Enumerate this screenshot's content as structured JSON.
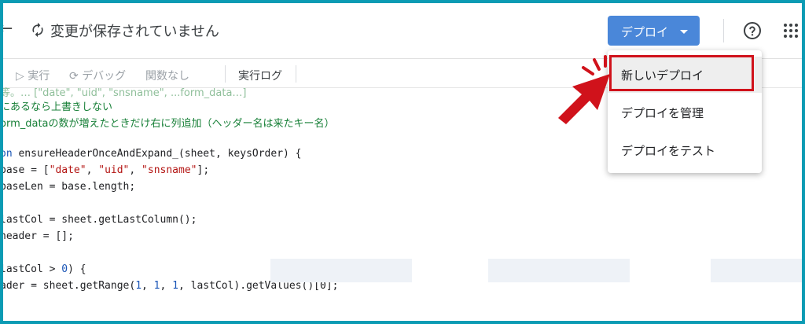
{
  "header": {
    "back_glyph": "←",
    "status": "変更が保存されていません",
    "deploy_label": "デプロイ"
  },
  "toolbar": {
    "run": "実行",
    "debug": "デバッグ",
    "function": "関数なし",
    "log": "実行ログ"
  },
  "menu": [
    "新しいデプロイ",
    "デプロイを管理",
    "デプロイをテスト"
  ],
  "code": {
    "l0": "等。… [\"date\", \"uid\", \"snsname\", ...form_data…]",
    "l1": "にあるなら上書きしない",
    "l2": "orm_dataの数が増えたときだけ右に列追加（ヘッダー名は来たキー名）",
    "l4a": "on ",
    "l4b": "ensureHeaderOnceAndExpand_(sheet, keysOrder) {",
    "l5a": "base = [",
    "l5b": "\"date\"",
    "l5c": ", ",
    "l5d": "\"uid\"",
    "l5e": ", ",
    "l5f": "\"snsname\"",
    "l5g": "];",
    "l6": "baseLen = base.length;",
    "l8": "lastCol = sheet.getLastColumn();",
    "l9": "header = [];",
    "l11a": "lastCol > ",
    "l11b": "0",
    "l11c": ") {",
    "l12a": "ader = sheet.getRange(",
    "l12b": "1",
    "l12c": ", ",
    "l12d": "1",
    "l12e": ", ",
    "l12f": "1",
    "l12g": ", lastCol).getValues()[0];"
  },
  "colors": {
    "accent": "#4a87d9",
    "highlight": "#d0121b",
    "frame": "#0b9bb4",
    "comment": "#188038",
    "string": "#b31412"
  }
}
